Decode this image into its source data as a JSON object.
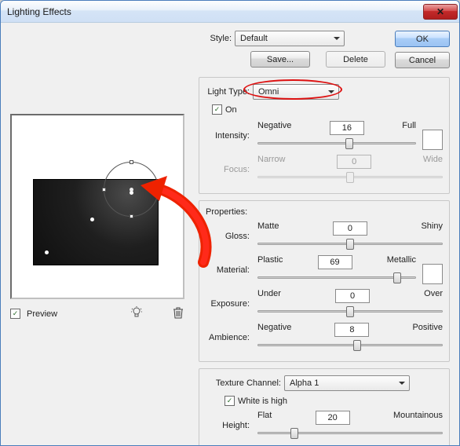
{
  "window": {
    "title": "Lighting Effects"
  },
  "ok": "OK",
  "cancel": "Cancel",
  "close_x": "✕",
  "style": {
    "label": "Style:",
    "value": "Default",
    "save": "Save...",
    "delete": "Delete"
  },
  "light": {
    "type_label": "Light Type:",
    "type_value": "Omni",
    "on_label": "On",
    "on_checked": true
  },
  "intensity": {
    "label": "Intensity:",
    "left": "Negative",
    "right": "Full",
    "value": "16",
    "pct": 58
  },
  "focus": {
    "label": "Focus:",
    "left": "Narrow",
    "right": "Wide",
    "value": "0",
    "pct": 50
  },
  "properties_label": "Properties:",
  "gloss": {
    "label": "Gloss:",
    "left": "Matte",
    "right": "Shiny",
    "value": "0",
    "pct": 50
  },
  "material": {
    "label": "Material:",
    "left": "Plastic",
    "right": "Metallic",
    "value": "69",
    "pct": 88
  },
  "exposure": {
    "label": "Exposure:",
    "left": "Under",
    "right": "Over",
    "value": "0",
    "pct": 50
  },
  "ambience": {
    "label": "Ambience:",
    "left": "Negative",
    "right": "Positive",
    "value": "8",
    "pct": 54
  },
  "tex": {
    "label": "Texture Channel:",
    "value": "Alpha 1",
    "white_label": "White is high",
    "white_checked": true
  },
  "height": {
    "label": "Height:",
    "left": "Flat",
    "right": "Mountainous",
    "value": "20",
    "pct": 20
  },
  "preview": {
    "label": "Preview",
    "checked": true
  },
  "icons": {
    "bulb": "light-bulb-icon",
    "trash": "trash-icon"
  }
}
